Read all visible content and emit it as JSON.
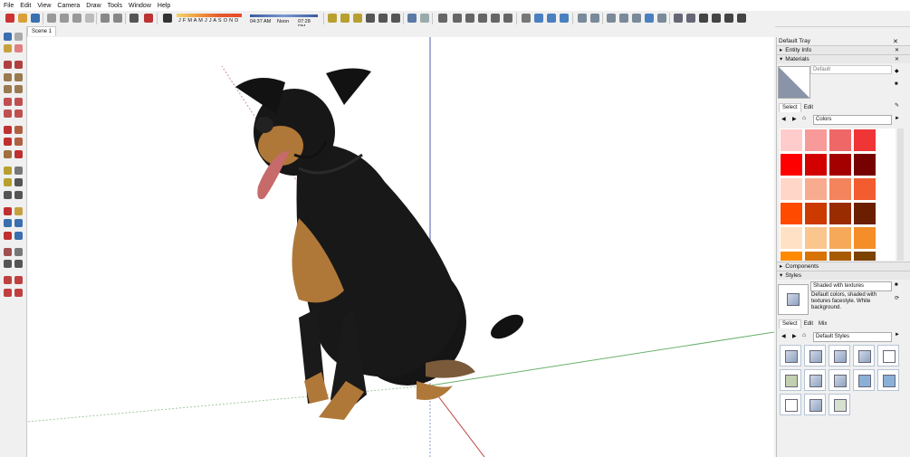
{
  "menu": [
    "File",
    "Edit",
    "View",
    "Camera",
    "Draw",
    "Tools",
    "Window",
    "Help"
  ],
  "shadow": {
    "months": "J F M A M J J A S O N D",
    "time_start": "04:37 AM",
    "time_mid": "Noon",
    "time_end": "07:28 PM"
  },
  "scene_tab": "Scene 1",
  "tray": {
    "title": "Default Tray",
    "entity_info": "Entity Info",
    "materials": "Materials",
    "material_name": "Default",
    "select_tab": "Select",
    "edit_tab": "Edit",
    "library": "Colors",
    "components": "Components",
    "styles": "Styles",
    "style_name": "Shaded with textures",
    "style_desc": "Default colors, shaded with textures facestyle. White background.",
    "style_select_tab": "Select",
    "style_edit_tab": "Edit",
    "style_mix_tab": "Mix",
    "style_library": "Default Styles"
  },
  "colors": {
    "swatches": [
      "#ffcccc",
      "#f99a9a",
      "#f06767",
      "#ef3535",
      "#ff0000",
      "#d30000",
      "#a50000",
      "#770000",
      "#ffd6c8",
      "#f9ab90",
      "#f4845c",
      "#f25c2e",
      "#ff4a00",
      "#cc3a00",
      "#992c00",
      "#6b1f00",
      "#ffe2c6",
      "#fbc58e",
      "#f7a95a",
      "#f58e28",
      "#ff8a00",
      "#d77300",
      "#a85a00",
      "#7b4200"
    ],
    "accent": "#0078d7"
  }
}
